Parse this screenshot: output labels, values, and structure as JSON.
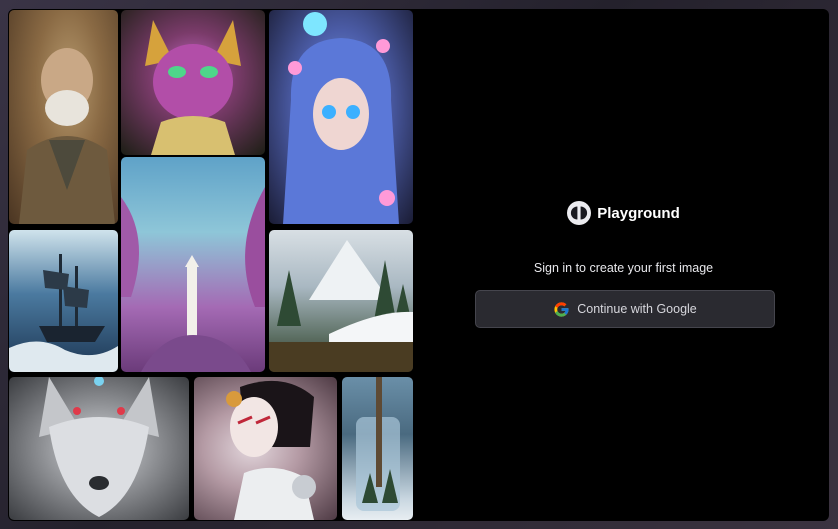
{
  "brand": {
    "name": "Playground",
    "logo_icon": "playground-logo-icon"
  },
  "signin": {
    "subtitle": "Sign in to create your first image",
    "google_button_label": "Continue with Google",
    "google_icon": "google-icon"
  },
  "gallery": {
    "images": [
      "old-man-portrait",
      "jeweled-cat",
      "blue-haired-girl-with-flowers",
      "lighthouse-fantasy-landscape",
      "ghost-ship-at-sea",
      "snowy-mountain-forest",
      "silver-wolf",
      "robot-geisha",
      "forest-in-glass-jar"
    ]
  },
  "colors": {
    "panel_background": "#000000",
    "button_background": "#2a2a30",
    "button_border": "#45454d",
    "text_primary": "#ffffff",
    "text_secondary": "#e8e8ec"
  }
}
